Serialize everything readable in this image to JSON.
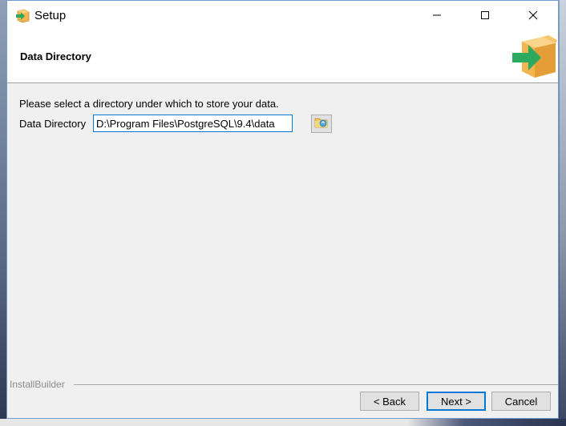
{
  "window": {
    "title": "Setup",
    "controls": {
      "minimize": "minimize-icon",
      "maximize": "maximize-icon",
      "close": "close-icon"
    }
  },
  "header": {
    "title": "Data Directory",
    "logo": "installer-box-arrow-icon"
  },
  "content": {
    "instruction": "Please select a directory under which to store your data.",
    "directory_label": "Data Directory",
    "directory_value": "D:\\Program Files\\PostgreSQL\\9.4\\data",
    "browse_icon": "folder-browse-icon"
  },
  "footer": {
    "brand": "InstallBuilder",
    "back_label": "< Back",
    "next_label": "Next >",
    "cancel_label": "Cancel"
  },
  "colors": {
    "accent": "#0078d7",
    "arrow_green": "#2daa5f",
    "box_orange": "#f2b450"
  }
}
